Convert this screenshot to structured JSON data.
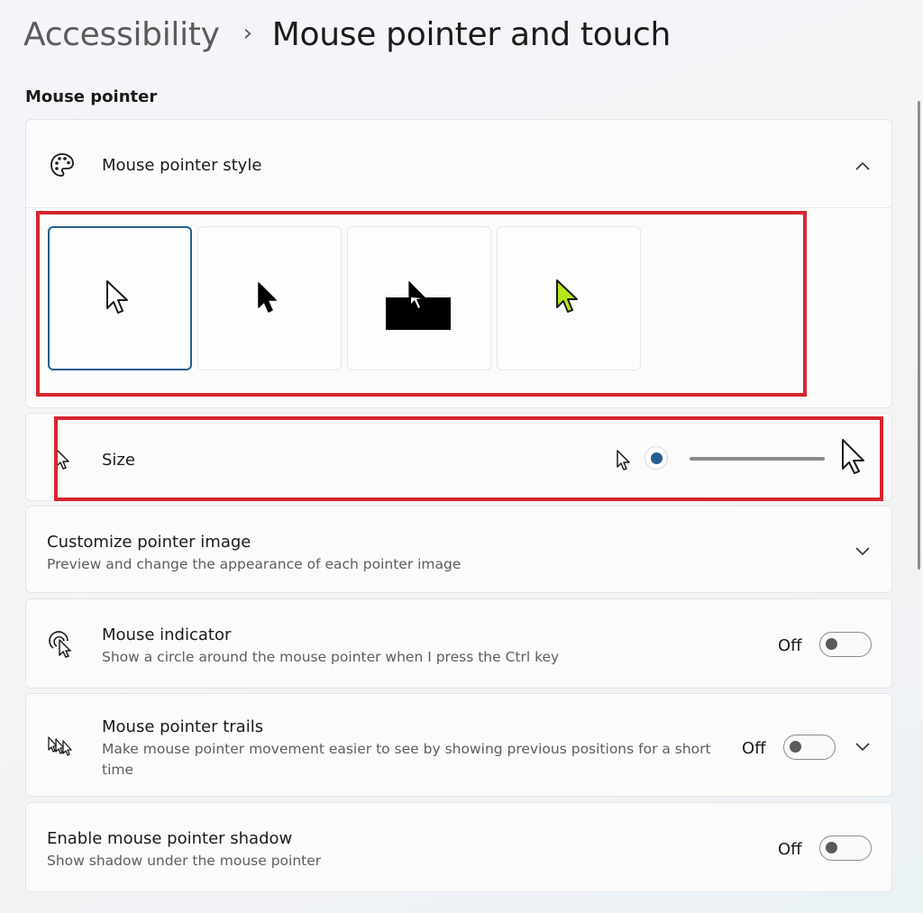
{
  "breadcrumb": {
    "parent": "Accessibility",
    "separator": "›",
    "current": "Mouse pointer and touch"
  },
  "section": {
    "title": "Mouse pointer"
  },
  "pointer_style": {
    "label": "Mouse pointer style",
    "icon": "palette-icon",
    "expanded": true,
    "options": [
      {
        "name": "white",
        "selected": true
      },
      {
        "name": "black",
        "selected": false
      },
      {
        "name": "inverted",
        "selected": false
      },
      {
        "name": "custom",
        "selected": false,
        "color": "#b5e61d"
      }
    ]
  },
  "size": {
    "label": "Size",
    "icon": "pointer-icon",
    "value": 1,
    "min": 1,
    "max": 15
  },
  "customize": {
    "label": "Customize pointer image",
    "description": "Preview and change the appearance of each pointer image"
  },
  "indicator": {
    "label": "Mouse indicator",
    "description": "Show a circle around the mouse pointer when I press the Ctrl key",
    "state": "Off",
    "icon": "mouse-indicator-icon"
  },
  "trails": {
    "label": "Mouse pointer trails",
    "description_line1": "Make mouse pointer movement easier to see by showing previous positions for a short",
    "description_line2": "time",
    "state": "Off",
    "icon": "pointer-trails-icon"
  },
  "shadow": {
    "label": "Enable mouse pointer shadow",
    "description": "Show shadow under the mouse pointer",
    "state": "Off"
  },
  "colors": {
    "accent": "#235e91",
    "highlight": "#d7262f",
    "custom_pointer": "#b5e61d"
  }
}
